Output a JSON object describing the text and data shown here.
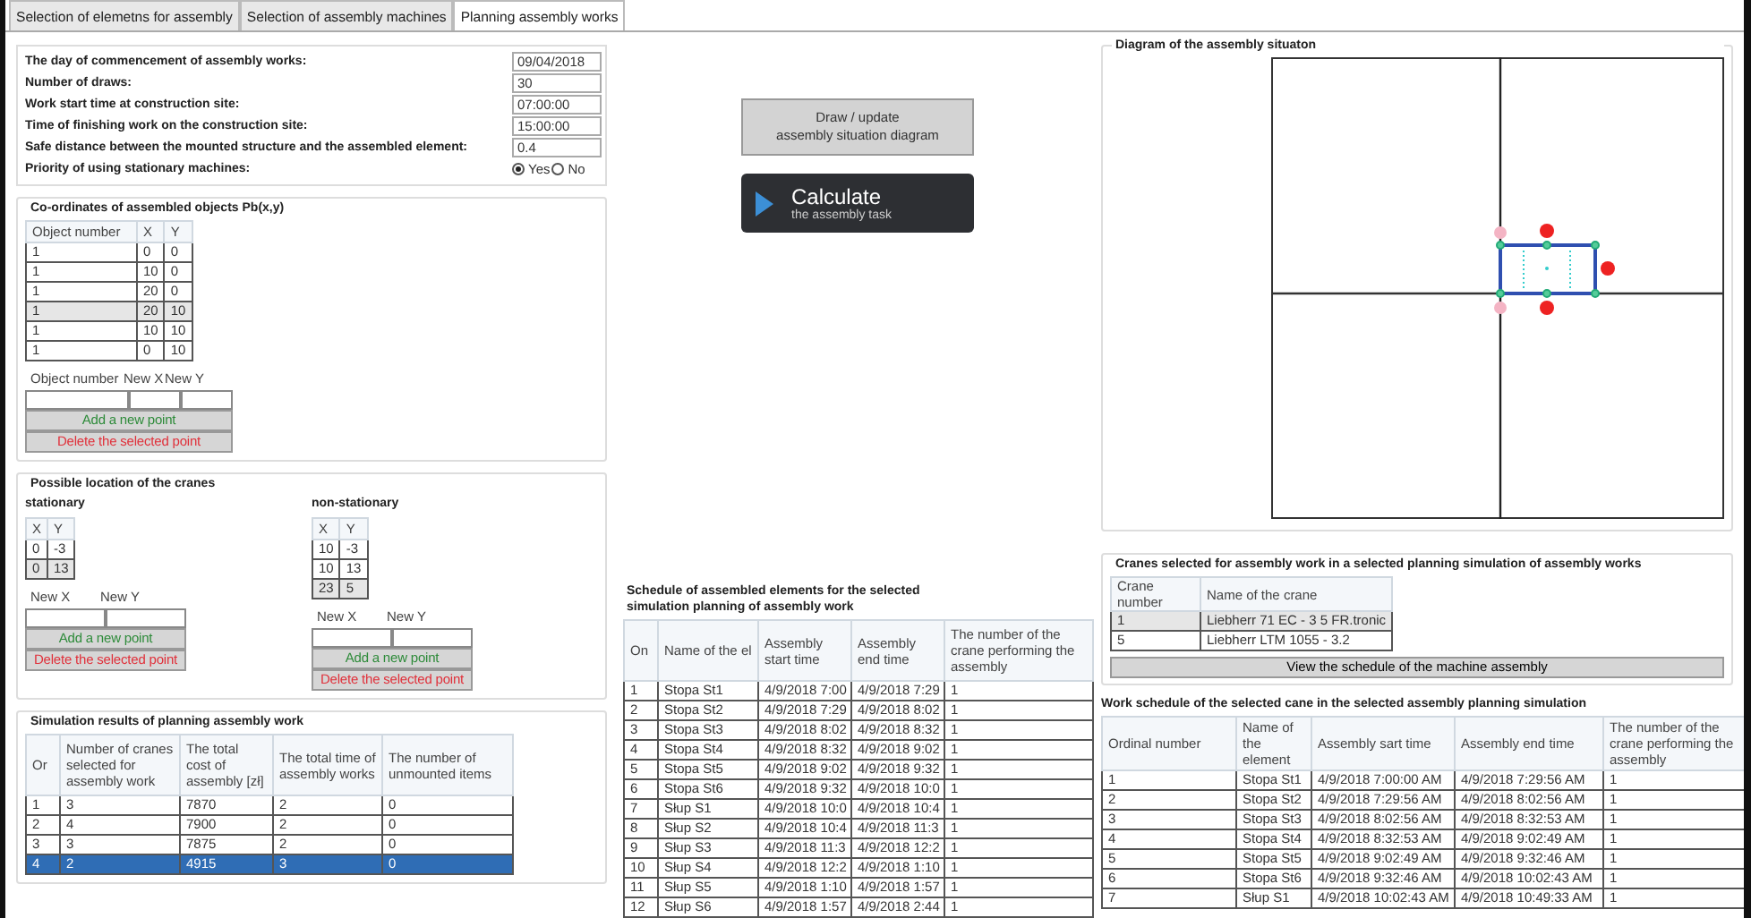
{
  "tabs": [
    {
      "label": "Selection of elemetns for assembly",
      "selected": false
    },
    {
      "label": "Selection of assembly machines",
      "selected": false
    },
    {
      "label": "Planning assembly works",
      "selected": true
    }
  ],
  "parameters": [
    {
      "label": "The day of commencement of assembly works:",
      "value": "09/04/2018"
    },
    {
      "label": "Number of draws:",
      "value": "30"
    },
    {
      "label": "Work start time at construction site:",
      "value": "07:00:00"
    },
    {
      "label": "Time of finishing work on the construction site:",
      "value": "15:00:00"
    },
    {
      "label": "Safe distance between the mounted structure and the assembled element:",
      "value": "0.4"
    }
  ],
  "priority": {
    "label": "Priority of using stationary machines:",
    "options": [
      {
        "label": "Yes",
        "selected": true
      },
      {
        "label": "No",
        "selected": false
      }
    ]
  },
  "coordinates": {
    "title": "Co-ordinates of assembled objects Pb(x,y)",
    "columns": [
      "Object number",
      "X",
      "Y"
    ],
    "rows": [
      {
        "cells": [
          "1",
          "0",
          "0"
        ],
        "selected": false
      },
      {
        "cells": [
          "1",
          "10",
          "0"
        ],
        "selected": false
      },
      {
        "cells": [
          "1",
          "20",
          "0"
        ],
        "selected": false
      },
      {
        "cells": [
          "1",
          "20",
          "10"
        ],
        "selected": true
      },
      {
        "cells": [
          "1",
          "10",
          "10"
        ],
        "selected": false
      },
      {
        "cells": [
          "1",
          "0",
          "10"
        ],
        "selected": false
      }
    ],
    "new_fields": [
      "Object number",
      "New X",
      "New Y"
    ],
    "add_button": "Add a new point",
    "delete_button": "Delete the selected point"
  },
  "cranes_location": {
    "title": "Possible location of the cranes",
    "groups": [
      {
        "title": "stationary",
        "columns": [
          "X",
          "Y"
        ],
        "rows": [
          {
            "cells": [
              "0",
              "-3"
            ],
            "selected": false
          },
          {
            "cells": [
              "0",
              "13"
            ],
            "selected": true
          }
        ],
        "new_fields": [
          "New X",
          "New Y"
        ],
        "add_button": "Add a new point",
        "delete_button": "Delete the selected point"
      },
      {
        "title": "non-stationary",
        "columns": [
          "X",
          "Y"
        ],
        "rows": [
          {
            "cells": [
              "10",
              "-3"
            ],
            "selected": false
          },
          {
            "cells": [
              "10",
              "13"
            ],
            "selected": false
          },
          {
            "cells": [
              "23",
              "5"
            ],
            "selected": true
          }
        ],
        "new_fields": [
          "New X",
          "New Y"
        ],
        "add_button": "Add a new point",
        "delete_button": "Delete the selected point"
      }
    ]
  },
  "simulation": {
    "title": "Simulation results of planning assembly work",
    "columns": [
      "Or",
      "Number of cranes selected for assembly work",
      "The total cost of assembly [zł]",
      "The total time of assembly works",
      "The number of unmounted items"
    ],
    "rows": [
      {
        "cells": [
          "1",
          "3",
          "7870",
          "2",
          "0"
        ],
        "selected": false
      },
      {
        "cells": [
          "2",
          "4",
          "7900",
          "2",
          "0"
        ],
        "selected": false
      },
      {
        "cells": [
          "3",
          "3",
          "7875",
          "2",
          "0"
        ],
        "selected": false
      },
      {
        "cells": [
          "4",
          "2",
          "4915",
          "3",
          "0"
        ],
        "selected": true
      }
    ]
  },
  "draw_button": [
    "Draw / update",
    "assembly situation diagram"
  ],
  "calculate_button": {
    "title": "Calculate",
    "subtitle": "the assembly task"
  },
  "schedule": {
    "title": "Schedule of assembled elements for the selected simulation planning of assembly work",
    "columns": [
      "On",
      "Name of the el",
      "Assembly start time",
      "Assembly end time",
      "The number of the crane performing the assembly"
    ],
    "rows": [
      {
        "cells": [
          "1",
          "Stopa St1",
          "4/9/2018 7:00",
          "4/9/2018 7:29",
          "1"
        ],
        "selected": false
      },
      {
        "cells": [
          "2",
          "Stopa St2",
          "4/9/2018 7:29",
          "4/9/2018 8:02",
          "1"
        ],
        "selected": false
      },
      {
        "cells": [
          "3",
          "Stopa St3",
          "4/9/2018 8:02",
          "4/9/2018 8:32",
          "1"
        ],
        "selected": false
      },
      {
        "cells": [
          "4",
          "Stopa St4",
          "4/9/2018 8:32",
          "4/9/2018 9:02",
          "1"
        ],
        "selected": false
      },
      {
        "cells": [
          "5",
          "Stopa St5",
          "4/9/2018 9:02",
          "4/9/2018 9:32",
          "1"
        ],
        "selected": false
      },
      {
        "cells": [
          "6",
          "Stopa St6",
          "4/9/2018 9:32",
          "4/9/2018 10:0",
          "1"
        ],
        "selected": false
      },
      {
        "cells": [
          "7",
          "Słup S1",
          "4/9/2018 10:0",
          "4/9/2018 10:4",
          "1"
        ],
        "selected": false
      },
      {
        "cells": [
          "8",
          "Słup S2",
          "4/9/2018 10:4",
          "4/9/2018 11:3",
          "1"
        ],
        "selected": false
      },
      {
        "cells": [
          "9",
          "Słup S3",
          "4/9/2018 11:3",
          "4/9/2018 12:2",
          "1"
        ],
        "selected": false
      },
      {
        "cells": [
          "10",
          "Słup S4",
          "4/9/2018 12:2",
          "4/9/2018 1:10",
          "1"
        ],
        "selected": false
      },
      {
        "cells": [
          "11",
          "Słup S5",
          "4/9/2018 1:10",
          "4/9/2018 1:57",
          "1"
        ],
        "selected": false
      },
      {
        "cells": [
          "12",
          "Słup S6",
          "4/9/2018 1:57",
          "4/9/2018 2:44",
          "1"
        ],
        "selected": false
      }
    ]
  },
  "diagram": {
    "title": "Diagram of the assembly situaton"
  },
  "selected_cranes": {
    "title": "Cranes selected for assembly work in a selected planning simulation of assembly works",
    "columns": [
      "Crane number",
      "Name of the crane"
    ],
    "rows": [
      {
        "cells": [
          "1",
          "Liebherr 71 EC - 3 5 FR.tronic"
        ],
        "selected": true
      },
      {
        "cells": [
          "5",
          "Liebherr LTM 1055 - 3.2"
        ],
        "selected": false
      }
    ],
    "button": "View the schedule of the machine assembly"
  },
  "crane_schedule": {
    "title": "Work schedule of the selected cane in the selected assembly planning simulation",
    "columns": [
      "Ordinal number",
      "Name of the element",
      "Assembly sart time",
      "Assembly end time",
      "The number of the crane performing the assembly"
    ],
    "rows": [
      {
        "cells": [
          "1",
          "Stopa St1",
          "4/9/2018 7:00:00 AM",
          "4/9/2018 7:29:56 AM",
          "1"
        ],
        "selected": false
      },
      {
        "cells": [
          "2",
          "Stopa St2",
          "4/9/2018 7:29:56 AM",
          "4/9/2018 8:02:56 AM",
          "1"
        ],
        "selected": false
      },
      {
        "cells": [
          "3",
          "Stopa St3",
          "4/9/2018 8:02:56 AM",
          "4/9/2018 8:32:53 AM",
          "1"
        ],
        "selected": false
      },
      {
        "cells": [
          "4",
          "Stopa St4",
          "4/9/2018 8:32:53 AM",
          "4/9/2018 9:02:49 AM",
          "1"
        ],
        "selected": false
      },
      {
        "cells": [
          "5",
          "Stopa St5",
          "4/9/2018 9:02:49 AM",
          "4/9/2018 9:32:46 AM",
          "1"
        ],
        "selected": false
      },
      {
        "cells": [
          "6",
          "Stopa St6",
          "4/9/2018 9:32:46 AM",
          "4/9/2018 10:02:43 AM",
          "1"
        ],
        "selected": false
      },
      {
        "cells": [
          "7",
          "Słup S1",
          "4/9/2018 10:02:43 AM",
          "4/9/2018 10:49:33 AM",
          "1"
        ],
        "selected": false
      }
    ]
  }
}
